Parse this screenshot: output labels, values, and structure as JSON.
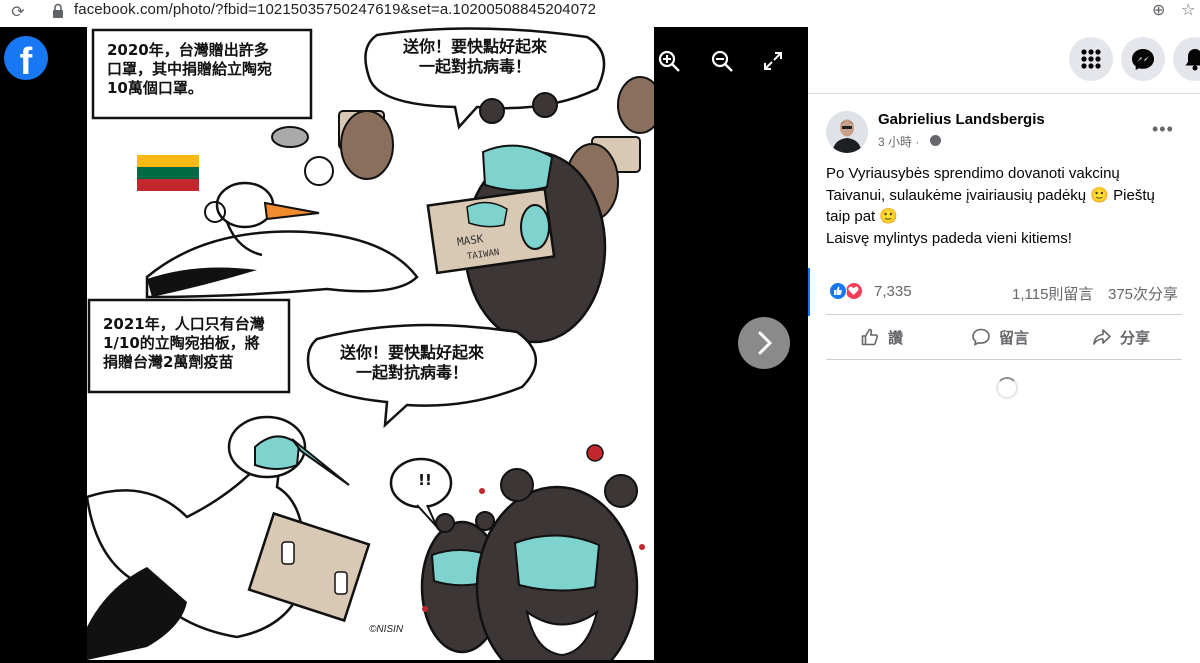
{
  "browser": {
    "url": "facebook.com/photo/?fbid=10215035750247619&set=a.10200508845204072",
    "reload_glyph": "⟳",
    "zoom_glyph": "⊕",
    "star_glyph": "☆"
  },
  "viewer": {
    "logo_letter": "f",
    "comic": {
      "panel1_caption": "2020年，台灣贈出許多\n口罩，其中捐贈給立陶宛\n10萬個口罩。",
      "panel1_bubble": "送你！要快點好起來\n一起對抗病毒！",
      "box_label": "MASK",
      "box_sublabel": "TAIWAN",
      "panel2_caption": "2021年，人口只有台灣\n1/10的立陶宛拍板，將\n捐贈台灣2萬劑疫苗",
      "panel2_bubble": "送你！要快點好起來\n一起對抗病毒！",
      "exclaim_bubble": "!!",
      "signature": "©NISIN"
    }
  },
  "post": {
    "author": "Gabrielius Landsbergis",
    "time": "3 小時 ·",
    "more": "•••",
    "text_lines": [
      "Po Vyriausybės sprendimo dovanoti vakcinų",
      "Taivanui, sulaukėme įvairiausių padėkų 🙂 Pieštų",
      "taip pat 🙂",
      "Laisvę mylintys padeda vieni kitiems!"
    ],
    "reaction_count": "7,335",
    "comments": "1,115則留言",
    "shares": "375次分享",
    "actions": {
      "like": "讚",
      "comment": "留言",
      "share": "分享"
    }
  },
  "colors": {
    "facebook_blue": "#1877f2",
    "love_red": "#f33e58",
    "lithuania_yellow": "#fdb913",
    "lithuania_green": "#006a44",
    "lithuania_red": "#c1272d",
    "mask_teal": "#7fd3cf"
  },
  "icons": {
    "zoom_in": "zoom-in-icon",
    "zoom_out": "zoom-out-icon",
    "fullscreen": "fullscreen-icon",
    "next": "chevron-right-icon",
    "menu": "grid-menu-icon",
    "messenger": "messenger-icon",
    "notifications": "bell-icon"
  }
}
